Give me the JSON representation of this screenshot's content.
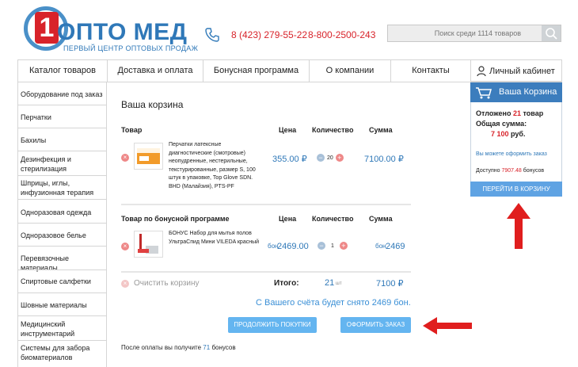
{
  "header": {
    "logo_digit": "1",
    "logo_title": "ОПТО МЕД",
    "logo_subtitle": "ПЕРВЫЙ ЦЕНТР ОПТОВЫХ ПРОДАЖ",
    "phone1": "8 (423) 279-55-22",
    "phone2": "8-800-2500-243",
    "search_placeholder": "Поиск среди 1114 товаров"
  },
  "nav": {
    "items": [
      "Каталог товаров",
      "Доставка и оплата",
      "Бонусная программа",
      "О компании",
      "Контакты"
    ],
    "account": "Личный кабинет"
  },
  "sidebar": {
    "items": [
      "Оборудование под заказ",
      "Перчатки",
      "Бахилы",
      "Дезинфекция и стерилизация",
      "Шприцы, иглы, инфузионная терапия",
      "Одноразовая одежда",
      "Одноразовое белье",
      "Перевязочные материалы",
      "Спиртовые салфетки",
      "Шовные материалы",
      "Медицинский инструментарий",
      "Системы для забора биоматериалов"
    ]
  },
  "cart": {
    "title": "Ваша корзина",
    "headers": {
      "product": "Товар",
      "price": "Цена",
      "qty": "Количество",
      "sum": "Сумма"
    },
    "items": [
      {
        "desc": "Перчатки латексные диагностические (смотровые) неопудренные, нестерильные, текстурированные, размер S, 100 штук в упаковке, Top Glove SDN. BHD (Малайзия), PTS-PF",
        "price": "355.00 ₽",
        "qty": "20",
        "sum": "7100.00 ₽"
      }
    ],
    "bonus_headers": {
      "product": "Товар по бонусной программе",
      "price": "Цена",
      "qty": "Количество",
      "sum": "Сумма"
    },
    "bonus_items": [
      {
        "desc": "БОНУС Набор для мытья полов УльтраСпид Мини VILEDA красный",
        "price_prefix": "бон",
        "price": "2469.00",
        "qty": "1",
        "sum_prefix": "бон",
        "sum": "2469"
      }
    ],
    "clear": "Очистить корзину",
    "total_label": "Итого:",
    "total_qty": "21",
    "total_qty_unit": "шт",
    "total_sum": "7100 ₽",
    "bonus_note": "С Вашего счёта будет снято 2469 бон.",
    "continue_btn": "ПРОДОЛЖИТЬ ПОКУПКИ",
    "checkout_btn": "ОФОРМИТЬ ЗАКАЗ",
    "after_pay_prefix": "После оплаты вы получите",
    "after_pay_value": "71",
    "after_pay_suffix": "бонусов"
  },
  "panel": {
    "title": "Ваша Корзина",
    "deferred_prefix": "Отложено",
    "deferred_count": "21",
    "deferred_suffix": "товар",
    "sum_label": "Общая сумма:",
    "sum_value": "7 100",
    "sum_unit": "руб.",
    "can_order": "Вы можете оформить заказ",
    "available_prefix": "Доступно",
    "available_value": "7907.48",
    "available_suffix": "бонусов",
    "go_btn": "ПЕРЕЙТИ В КОРЗИНУ"
  },
  "colors": {
    "brand_blue": "#2f78b8",
    "red": "#d8232a",
    "button_blue": "#64b5f0",
    "panel_blue": "#3c7dbd"
  },
  "icons": [
    "phone-icon",
    "search-icon",
    "cart-icon",
    "user-icon",
    "delete-icon",
    "minus-icon",
    "plus-icon",
    "arrow-up-annotation",
    "arrow-left-annotation"
  ]
}
